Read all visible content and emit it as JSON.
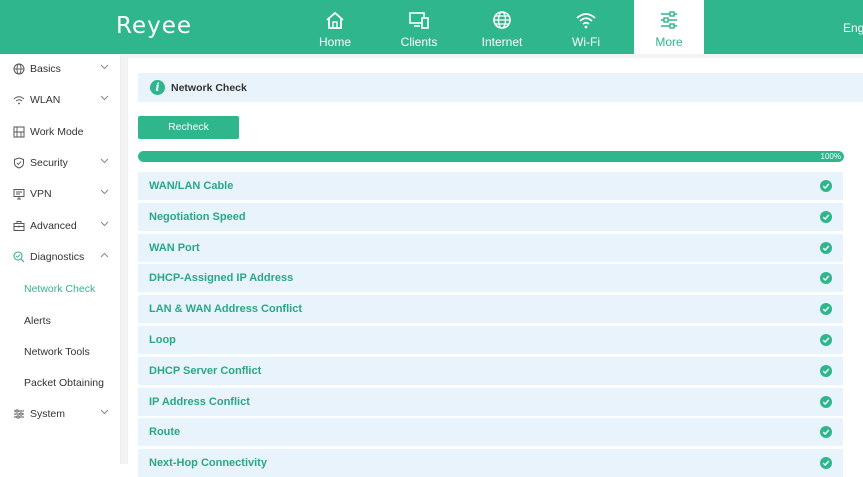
{
  "brand": {
    "logo_text": "Reyee",
    "accent": "#2fb68d"
  },
  "top_nav": [
    {
      "label": "Home",
      "icon": "home-icon"
    },
    {
      "label": "Clients",
      "icon": "devices-icon"
    },
    {
      "label": "Internet",
      "icon": "globe-icon"
    },
    {
      "label": "Wi-Fi",
      "icon": "wifi-icon"
    },
    {
      "label": "More",
      "icon": "sliders-icon",
      "active": true
    }
  ],
  "language": "Eng",
  "sidebar": {
    "items": [
      {
        "label": "Basics",
        "icon": "globe-icon"
      },
      {
        "label": "WLAN",
        "icon": "wifi-icon"
      },
      {
        "label": "Work Mode",
        "icon": "grid-icon"
      },
      {
        "label": "Security",
        "icon": "shield-icon"
      },
      {
        "label": "VPN",
        "icon": "monitor-icon"
      },
      {
        "label": "Advanced",
        "icon": "toolbox-icon"
      },
      {
        "label": "Diagnostics",
        "icon": "diagnostics-icon",
        "expanded": true
      },
      {
        "label": "System",
        "icon": "gear-icon"
      }
    ],
    "diagnostics_sub": [
      {
        "label": "Network Check",
        "active": true
      },
      {
        "label": "Alerts"
      },
      {
        "label": "Network Tools"
      },
      {
        "label": "Packet Obtaining"
      }
    ]
  },
  "main": {
    "title": "Network Check",
    "recheck_label": "Recheck",
    "progress": {
      "percent": 100,
      "text": "100%"
    },
    "checks": [
      {
        "name": "WAN/LAN Cable",
        "status": "ok"
      },
      {
        "name": "Negotiation Speed",
        "status": "ok"
      },
      {
        "name": "WAN Port",
        "status": "ok"
      },
      {
        "name": "DHCP-Assigned IP Address",
        "status": "ok"
      },
      {
        "name": "LAN & WAN Address Conflict",
        "status": "ok"
      },
      {
        "name": "Loop",
        "status": "ok"
      },
      {
        "name": "DHCP Server Conflict",
        "status": "ok"
      },
      {
        "name": "IP Address Conflict",
        "status": "ok"
      },
      {
        "name": "Route",
        "status": "ok"
      },
      {
        "name": "Next-Hop Connectivity",
        "status": "ok"
      }
    ]
  }
}
